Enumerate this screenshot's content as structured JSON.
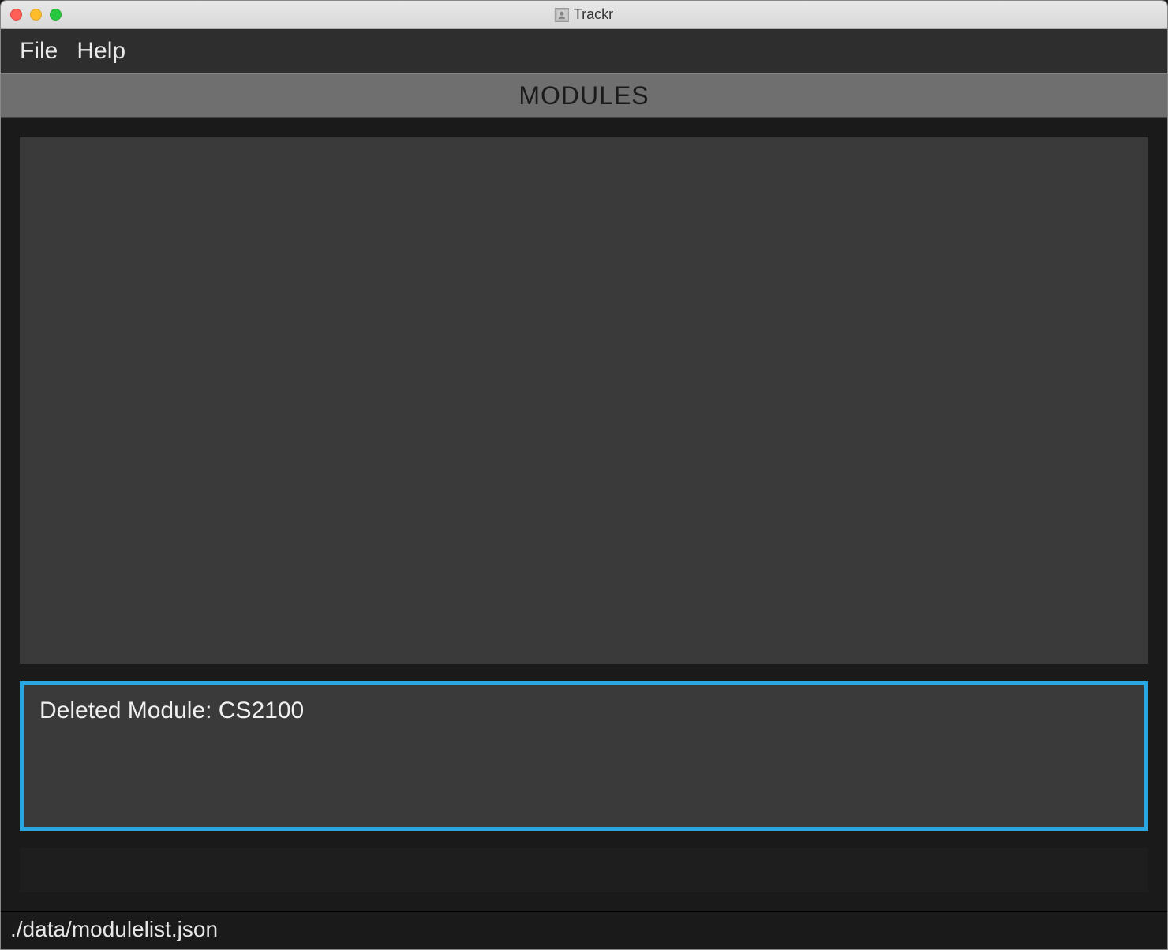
{
  "window": {
    "title": "Trackr"
  },
  "menubar": {
    "items": [
      "File",
      "Help"
    ]
  },
  "section": {
    "header": "MODULES"
  },
  "message": {
    "text": "Deleted Module: CS2100"
  },
  "command": {
    "value": ""
  },
  "status": {
    "path": "./data/modulelist.json"
  }
}
